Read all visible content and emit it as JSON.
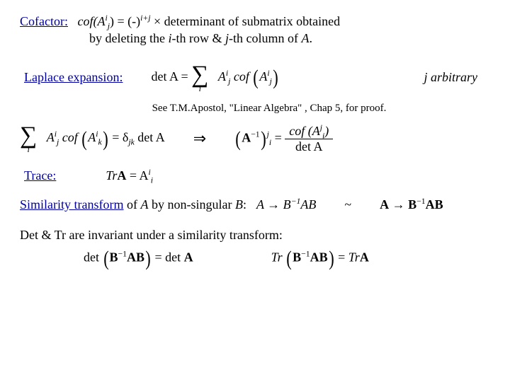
{
  "cofactor": {
    "label": "Cofactor:",
    "def_pre": "cof",
    "arg_open_base": "(A",
    "arg_sup": "i",
    "arg_sub": "j",
    "eq_sign": ") = (-)",
    "exp": "i+j",
    "rest_first": " × determinant of submatrix obtained",
    "rest_second": "by deleting the i-th row & j-th column of A."
  },
  "laplace": {
    "label": "Laplace expansion:",
    "formula_lhs": "det A = ",
    "sum_idx": "i",
    "term_A_base": "A",
    "term_A_sup": "i",
    "term_A_sub": "j",
    "cof_word": " cof ",
    "cof_arg_base": "A",
    "cof_arg_sup": "i",
    "cof_arg_sub": "j",
    "note": "j arbitrary"
  },
  "ref": "See T.M.Apostol, \"Linear Algebra\" , Chap 5, for proof.",
  "ortho": {
    "sum_idx": "i",
    "A1_base": "A",
    "A1_sup": "i",
    "A1_sub": "j",
    "cof_word": " cof ",
    "A2_base": "A",
    "A2_sup": "i",
    "A2_sub": "k",
    "eq": "= δ",
    "delta_sub": "jk",
    "det": " det A",
    "implies": "⇒",
    "inv_open": "(A",
    "inv_exp": "−1",
    "inv_close": ")",
    "inv_sup": "j",
    "inv_sub": "i",
    "frac_num_cof": "cof (A",
    "frac_num_sup": "j",
    "frac_num_sub": "i",
    "frac_num_close": ")",
    "frac_den": "det A"
  },
  "trace": {
    "label": "Trace:",
    "tr": "Tr",
    "A_bold": "A",
    "eq": " = A",
    "sup": "i",
    "sub": "i"
  },
  "sim": {
    "text": "Similarity transform of A by non-singular B:",
    "ABinvAB": "A → B",
    "exp1": "−1",
    "mid": "AB",
    "tilde": "~",
    "A_bold": "A",
    "arrow": " → ",
    "B_bold": "B",
    "AB_bold": "AB"
  },
  "inv": {
    "text": "Det & Tr are invariant under a similarity transform:",
    "det_lhs_open": "det (B",
    "exp1": "−1",
    "det_lhs_close": "AB) = det A",
    "tr_lhs_open": "Tr (B",
    "tr_lhs_close": "AB) = Tr",
    "tr_rhs": "A"
  }
}
